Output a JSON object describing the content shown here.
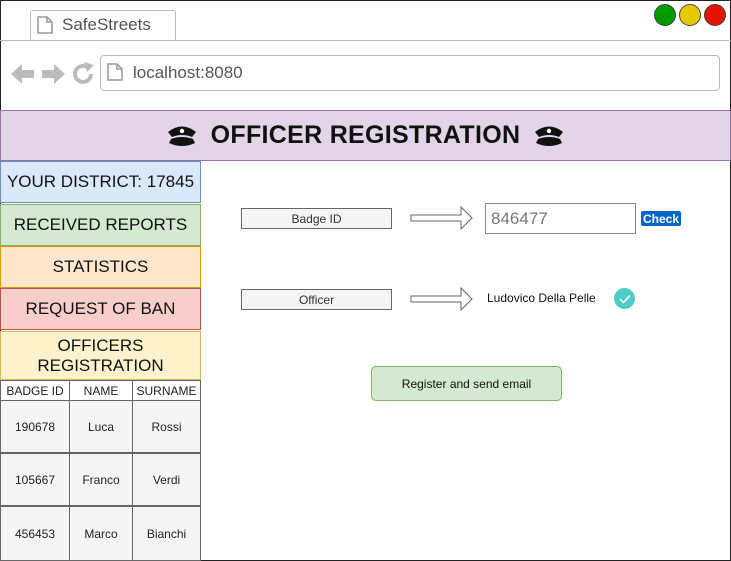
{
  "browser": {
    "tab_title": "SafeStreets",
    "url": "localhost:8080",
    "window_controls": [
      {
        "name": "green",
        "color": "#009900"
      },
      {
        "name": "yellow",
        "color": "#e6c800"
      },
      {
        "name": "red",
        "color": "#e51400"
      }
    ]
  },
  "header": {
    "title": "OFFICER REGISTRATION",
    "icon": "police-cap-icon"
  },
  "sidebar": {
    "items": [
      {
        "label": "YOUR DISTRICT: 17845",
        "color": "#dae8fc",
        "border": "#6c8ebf"
      },
      {
        "label": "RECEIVED REPORTS",
        "color": "#d5e8d4",
        "border": "#82b366"
      },
      {
        "label": "STATISTICS",
        "color": "#ffe6cc",
        "border": "#d79b00"
      },
      {
        "label": "REQUEST OF BAN",
        "color": "#f8cecc",
        "border": "#b85450"
      },
      {
        "label": "OFFICERS REGISTRATION",
        "color": "#fff2cc",
        "border": "#d6b656"
      }
    ]
  },
  "officers_table": {
    "headers": [
      "BADGE ID",
      "NAME",
      "SURNAME"
    ],
    "rows": [
      [
        "190678",
        "Luca",
        "Rossi"
      ],
      [
        "105667",
        "Franco",
        "Verdi"
      ],
      [
        "456453",
        "Marco",
        "Bianchi"
      ]
    ]
  },
  "form": {
    "badge_label": "Badge ID",
    "badge_value": "846477",
    "check_label": "Check",
    "officer_label": "Officer",
    "officer_name": "Ludovico Della Pelle",
    "register_label": "Register and send email"
  }
}
